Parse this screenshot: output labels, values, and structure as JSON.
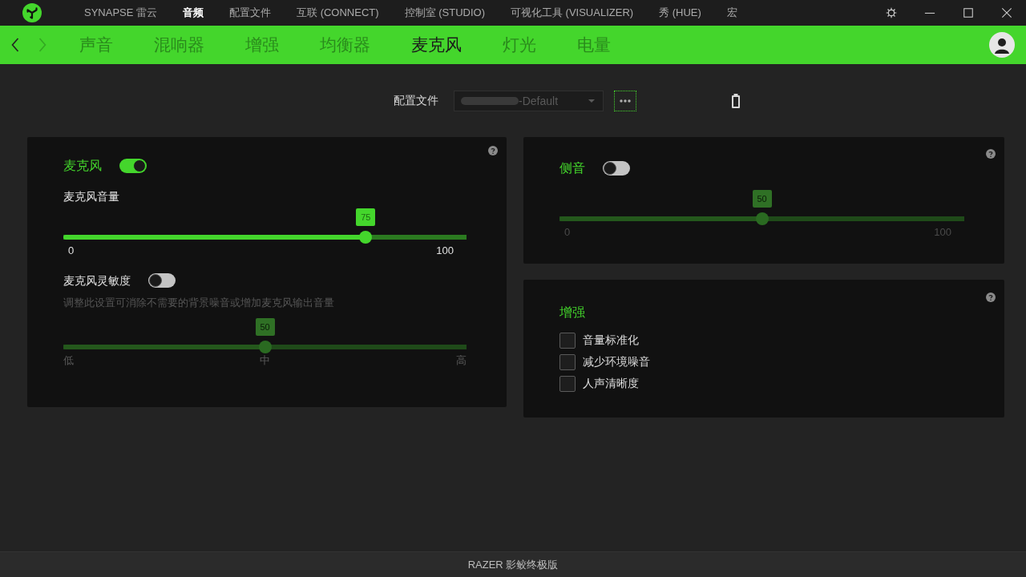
{
  "title_bar": {
    "nav": [
      {
        "label": "SYNAPSE 雷云",
        "selected": false
      },
      {
        "label": "音频",
        "selected": true
      },
      {
        "label": "配置文件",
        "selected": false
      },
      {
        "label": "互联 (CONNECT)",
        "selected": false
      },
      {
        "label": "控制室 (STUDIO)",
        "selected": false
      },
      {
        "label": "可视化工具 (VISUALIZER)",
        "selected": false
      },
      {
        "label": "秀 (HUE)",
        "selected": false
      },
      {
        "label": "宏",
        "selected": false
      }
    ]
  },
  "sub_nav": {
    "history": [
      {
        "kind": "back",
        "disabled": false
      },
      {
        "kind": "forward",
        "disabled": true
      }
    ],
    "tabs": [
      {
        "label": "声音",
        "selected": false
      },
      {
        "label": "混响器",
        "selected": false
      },
      {
        "label": "增强",
        "selected": false
      },
      {
        "label": "均衡器",
        "selected": false
      },
      {
        "label": "麦克风",
        "selected": true
      },
      {
        "label": "灯光",
        "selected": false
      },
      {
        "label": "电量",
        "selected": false
      }
    ]
  },
  "profile": {
    "label": "配置文件",
    "value": "-Default"
  },
  "microphone_panel": {
    "title": "麦克风",
    "on": true,
    "volume": {
      "label": "麦克风音量",
      "level": 0.75,
      "reading": "75",
      "min": "0",
      "max": "100"
    },
    "sensitivity": {
      "label": "麦克风灵敏度",
      "on": false,
      "description": "调整此设置可消除不需要的背景噪音或增加麦克风输出音量",
      "level": 0.5,
      "reading": "50",
      "scale": [
        "低",
        "中",
        "高"
      ]
    }
  },
  "sidetone_panel": {
    "title": "侧音",
    "on": false,
    "slider": {
      "level": 0.5,
      "reading": "50",
      "min": "0",
      "max": "100"
    }
  },
  "enhancement_panel": {
    "title": "增强",
    "options": [
      {
        "label": "音量标准化",
        "checked": false
      },
      {
        "label": "减少环境噪音",
        "checked": false
      },
      {
        "label": "人声清晰度",
        "checked": false
      }
    ]
  },
  "footer": {
    "device": "RAZER 影鲛终极版"
  }
}
